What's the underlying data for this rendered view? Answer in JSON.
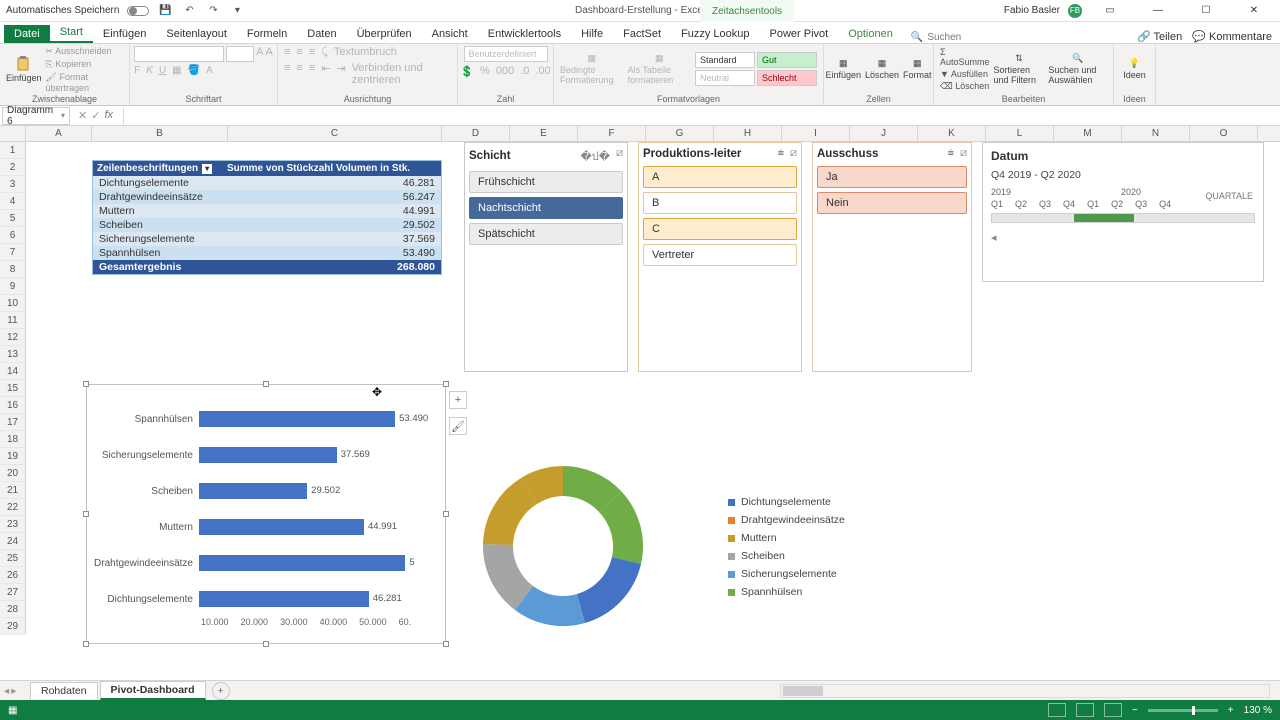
{
  "window": {
    "autosave_label": "Automatisches Speichern",
    "title": "Dashboard-Erstellung - Excel",
    "contextual_tab": "Zeitachsentools",
    "user": "Fabio Basler",
    "user_initials": "FB"
  },
  "tabs": {
    "file": "Datei",
    "start": "Start",
    "einfuegen": "Einfügen",
    "seitenlayout": "Seitenlayout",
    "formeln": "Formeln",
    "daten": "Daten",
    "ueberpruefen": "Überprüfen",
    "ansicht": "Ansicht",
    "entw": "Entwicklertools",
    "hilfe": "Hilfe",
    "factset": "FactSet",
    "fuzzy": "Fuzzy Lookup",
    "powerpivot": "Power Pivot",
    "optionen": "Optionen",
    "search": "Suchen",
    "share": "Teilen",
    "comments": "Kommentare"
  },
  "ribbon": {
    "clipboard": {
      "paste": "Einfügen",
      "cut": "Ausschneiden",
      "copy": "Kopieren",
      "fmtpaint": "Format übertragen",
      "label": "Zwischenablage"
    },
    "font_label": "Schriftart",
    "align": {
      "wrap": "Textumbruch",
      "merge": "Verbinden und zentrieren",
      "label": "Ausrichtung"
    },
    "number": {
      "fmt": "Benutzerdefiniert",
      "label": "Zahl"
    },
    "styles": {
      "cond": "Bedingte Formatierung",
      "tbl": "Als Tabelle formatieren",
      "std": "Standard",
      "gut": "Gut",
      "neu": "Neutral",
      "sch": "Schlecht",
      "label": "Formatvorlagen"
    },
    "cells": {
      "ins": "Einfügen",
      "del": "Löschen",
      "fmt": "Format",
      "label": "Zellen"
    },
    "editing": {
      "sum": "AutoSumme",
      "fill": "Ausfüllen",
      "clear": "Löschen",
      "sort": "Sortieren und Filtern",
      "find": "Suchen und Auswählen",
      "label": "Bearbeiten"
    },
    "ideas": {
      "btn": "Ideen",
      "label": "Ideen"
    }
  },
  "namebox": "Diagramm 6",
  "columns": [
    "A",
    "B",
    "C",
    "D",
    "E",
    "F",
    "G",
    "H",
    "I",
    "J",
    "K",
    "L",
    "M",
    "N",
    "O"
  ],
  "pivot": {
    "h1": "Zeilenbeschriftungen",
    "h2": "Summe von Stückzahl Volumen in Stk.",
    "rows": [
      {
        "l": "Dichtungselemente",
        "v": "46.281"
      },
      {
        "l": "Drahtgewindeeinsätze",
        "v": "56.247"
      },
      {
        "l": "Muttern",
        "v": "44.991"
      },
      {
        "l": "Scheiben",
        "v": "29.502"
      },
      {
        "l": "Sicherungselemente",
        "v": "37.569"
      },
      {
        "l": "Spannhülsen",
        "v": "53.490"
      }
    ],
    "total_l": "Gesamtergebnis",
    "total_v": "268.080"
  },
  "slicers": {
    "schicht": {
      "title": "Schicht",
      "items": [
        "Frühschicht",
        "Nachtschicht",
        "Spätschicht"
      ],
      "selected": 1
    },
    "leiter": {
      "title": "Produktions-leiter",
      "items": [
        "A",
        "B",
        "C",
        "Vertreter"
      ],
      "selected": [
        0,
        2
      ]
    },
    "ausschuss": {
      "title": "Ausschuss",
      "items": [
        "Ja",
        "Nein"
      ],
      "selected": [
        0,
        1
      ]
    }
  },
  "timeline": {
    "title": "Datum",
    "range": "Q4 2019 - Q2 2020",
    "unit": "QUARTALE",
    "years": [
      "2019",
      "2020"
    ],
    "quarters": [
      "Q1",
      "Q2",
      "Q3",
      "Q4",
      "Q1",
      "Q2",
      "Q3",
      "Q4"
    ]
  },
  "chart_data": {
    "type": "bar",
    "categories": [
      "Spannhülsen",
      "Sicherungselemente",
      "Scheiben",
      "Muttern",
      "Drahtgewindeeinsätze",
      "Dichtungselemente"
    ],
    "values": [
      53490,
      37569,
      29502,
      44991,
      56247,
      46281
    ],
    "labels": [
      "53.490",
      "37.569",
      "29.502",
      "44.991",
      "5",
      "46.281"
    ],
    "xlim": [
      0,
      60000
    ],
    "xticks": [
      "10.000",
      "20.000",
      "30.000",
      "40.000",
      "50.000",
      "60."
    ]
  },
  "donut": {
    "type": "pie",
    "legend": [
      "Dichtungselemente",
      "Drahtgewindeeinsätze",
      "Muttern",
      "Scheiben",
      "Sicherungselemente",
      "Spannhülsen"
    ],
    "colors": [
      "#4473c5",
      "#ec7e32",
      "#c69c2c",
      "#a5a5a5",
      "#5b9bd5",
      "#70ad47"
    ]
  },
  "sheets": {
    "t1": "Rohdaten",
    "t2": "Pivot-Dashboard"
  },
  "statusbar": {
    "zoom": "130 %"
  }
}
